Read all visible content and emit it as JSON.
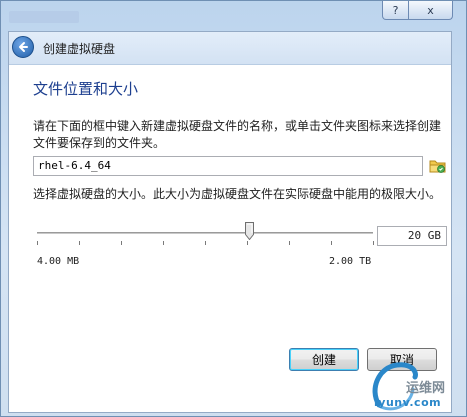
{
  "window": {
    "help_label": "?",
    "close_label": "x"
  },
  "header": {
    "back_icon": "back-arrow-icon",
    "title": "创建虚拟硬盘"
  },
  "section": {
    "title": "文件位置和大小",
    "description": "请在下面的框中键入新建虚拟硬盘文件的名称，或单击文件夹图标来选择创建文件要保存到的文件夹。"
  },
  "file": {
    "path_value": "rhel-6.4_64",
    "folder_icon": "folder-icon"
  },
  "size": {
    "description": "选择虚拟硬盘的大小。此大小为虚拟硬盘文件在实际硬盘中能用的极限大小。",
    "value": "20 GB",
    "min_label": "4.00 MB",
    "max_label": "2.00 TB",
    "slider_fraction": 0.63
  },
  "buttons": {
    "create": "创建",
    "cancel": "取消"
  },
  "watermark": {
    "text": "iyunv.com",
    "cn": "运维网"
  }
}
